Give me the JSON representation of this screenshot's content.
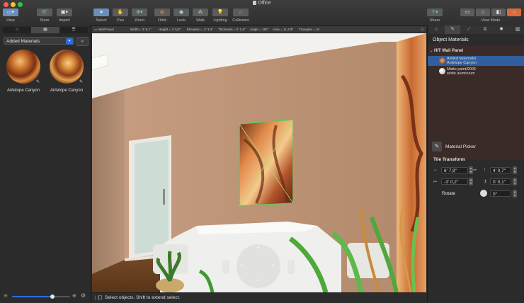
{
  "window": {
    "title": "Office"
  },
  "toolbar": {
    "view": "View",
    "store": "Store",
    "import": "Import",
    "select": "Select",
    "pan": "Pan",
    "zoom": "Zoom",
    "orbit": "Orbit",
    "look": "Look",
    "walk": "Walk",
    "lighting": "Lighting",
    "collisions": "Collisions",
    "share": "Share",
    "view_mode": "View Mode"
  },
  "infobar": {
    "object": "Wall Panel",
    "width": "Width = 3' 6,1\"",
    "height": "Height = 4' 5,8\"",
    "elevation": "Elevation = 3' 3,4\"",
    "thickness": "Thickness = 0' 1,6\"",
    "angle": "Angle = 180°",
    "area": "Area = 11,3 ft²",
    "triangles": "Triangles = 10"
  },
  "left": {
    "library": "Added Materials",
    "materials": [
      {
        "label": "Antelope Canyon"
      },
      {
        "label": "Antelope Canyon"
      }
    ]
  },
  "status": {
    "text": "Select objects. Shift to extend select."
  },
  "right": {
    "header": "Object Materials",
    "group": "HIT Wall Panel",
    "items": [
      {
        "line1": "Added Materials/",
        "line2": "Antelope Canyon"
      },
      {
        "line1": "Matte paint/9006",
        "line2": "white aluminium"
      }
    ],
    "picker": "Material Picker",
    "tile_transform": "Tile Transform",
    "tile_w": "6' 7,9\"",
    "tile_h": "4' 0,7\"",
    "offset_x": "-3' 0,2\"",
    "offset_y": "0' 0,1\"",
    "rotate_label": "Rotate",
    "rotate_value": "0°"
  },
  "colors": {
    "accent": "#2f6bd8",
    "selection": "#2f5f9e"
  }
}
